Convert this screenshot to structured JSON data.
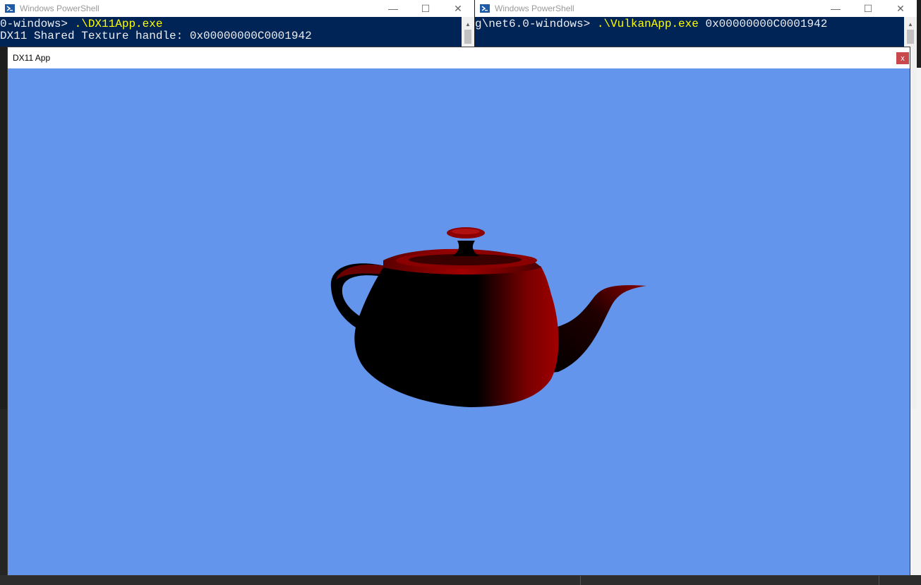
{
  "powershell_left": {
    "title": "Windows PowerShell",
    "line1_prompt": "0-windows> ",
    "line1_command": ".\\DX11App.exe",
    "line2": "DX11 Shared Texture handle: 0x00000000C0001942",
    "minimize_glyph": "—",
    "maximize_glyph": "☐",
    "close_glyph": "✕"
  },
  "powershell_right": {
    "title": "Windows PowerShell",
    "line1_prompt": "g\\net6.0-windows> ",
    "line1_command": ".\\VulkanApp.exe",
    "line1_arg": " 0x00000000C0001942",
    "minimize_glyph": "—",
    "maximize_glyph": "☐",
    "close_glyph": "✕"
  },
  "dx11_window": {
    "title": "DX11 App",
    "close_glyph": "x",
    "clear_color": "#6495ed",
    "teapot_color": "#8b0000"
  },
  "icons": {
    "powershell": "powershell-icon"
  }
}
